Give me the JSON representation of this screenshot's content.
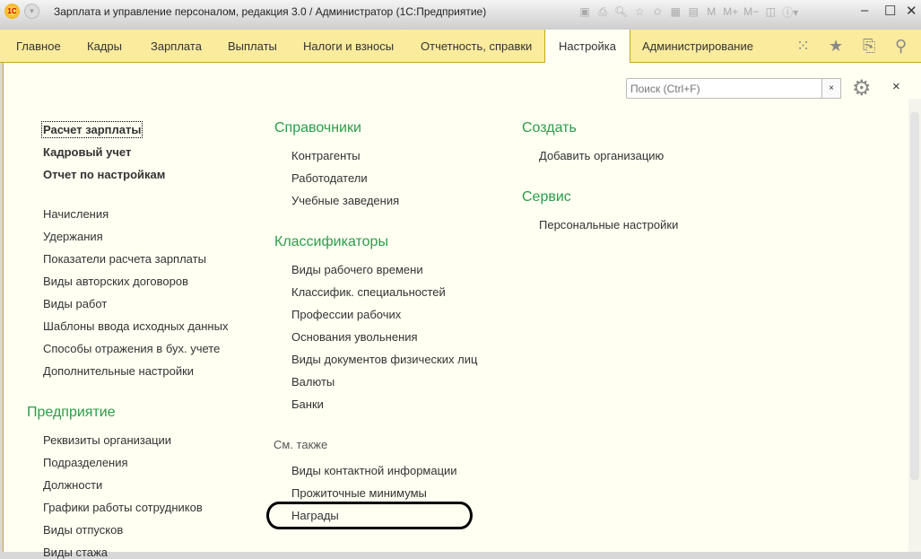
{
  "window": {
    "title": "Зарплата и управление персоналом, редакция 3.0 / Администратор  (1С:Предприятие)",
    "logo": "1C",
    "toolbar_icons": [
      "save-icon",
      "print-icon",
      "preview-icon",
      "favorite-add-icon",
      "favorite-icon",
      "calculator-icon",
      "calendar-icon",
      "M",
      "M+",
      "M−",
      "panel-icon",
      "info-icon"
    ]
  },
  "menu": {
    "tabs": [
      "Главное",
      "Кадры",
      "Зарплата",
      "Выплаты",
      "Налоги и взносы",
      "Отчетность, справки",
      "Настройка",
      "Администрирование"
    ],
    "active": "Настройка"
  },
  "search": {
    "placeholder": "Поиск (Ctrl+F)",
    "clear": "×"
  },
  "close": "×",
  "col1": {
    "bold": [
      "Расчет зарплаты",
      "Кадровый учет",
      "Отчет по настройкам"
    ],
    "items": [
      "Начисления",
      "Удержания",
      "Показатели расчета зарплаты",
      "Виды авторских договоров",
      "Виды работ",
      "Шаблоны ввода исходных данных",
      "Способы отражения в бух. учете",
      "Дополнительные настройки"
    ],
    "heading": "Предприятие",
    "items2": [
      "Реквизиты организации",
      "Подразделения",
      "Должности",
      "Графики работы сотрудников",
      "Виды отпусков",
      "Виды стажа"
    ]
  },
  "col2": {
    "heading1": "Справочники",
    "items1": [
      "Контрагенты",
      "Работодатели",
      "Учебные заведения"
    ],
    "heading2": "Классификаторы",
    "items2": [
      "Виды рабочего времени",
      "Классифик. специальностей",
      "Профессии рабочих",
      "Основания увольнения",
      "Виды документов физических лиц",
      "Валюты",
      "Банки"
    ],
    "see_also": "См. также",
    "items3": [
      "Виды контактной информации",
      "Прожиточные минимумы",
      "Награды"
    ]
  },
  "col3": {
    "heading1": "Создать",
    "items1": [
      "Добавить организацию"
    ],
    "heading2": "Сервис",
    "items2": [
      "Персональные настройки"
    ]
  }
}
